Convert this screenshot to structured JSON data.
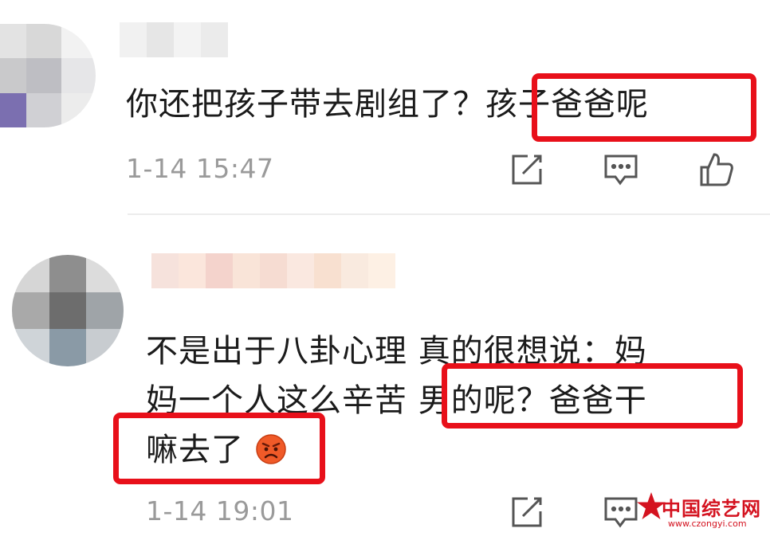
{
  "comments": [
    {
      "text": "你还把孩子带去剧组了？孩子爸爸呢",
      "time": "1-14 15:47"
    },
    {
      "text_line1": "不是出于八卦心理 真的很想说：妈",
      "text_line2": "妈一个人这么辛苦 男的呢？爸爸干",
      "text_line3": "嘛去了",
      "time": "1-14 19:01"
    }
  ],
  "icons": {
    "repost": "repost-icon",
    "comment": "comment-icon",
    "like": "thumbs-up-icon",
    "angry_emoji": "angry-face-emoji"
  },
  "colors": {
    "highlight": "#e8101a",
    "timestamp": "#9a9a9a",
    "watermark": "#d4121f"
  },
  "watermark": {
    "title": "中国综艺网",
    "url": "www.czongyi.com"
  }
}
